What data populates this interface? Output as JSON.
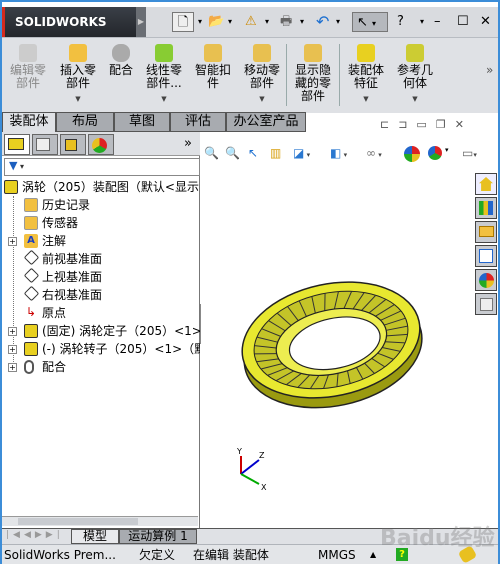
{
  "app": {
    "logo": "SOLIDWORKS"
  },
  "ribbon": {
    "buttons": [
      {
        "label": "编辑零\n部件",
        "disabled": true
      },
      {
        "label": "插入零\n部件"
      },
      {
        "label": "配合"
      },
      {
        "label": "线性零\n部件..."
      },
      {
        "label": "智能扣\n件"
      },
      {
        "label": "移动零\n部件"
      },
      {
        "label": "显示隐\n藏的零\n部件"
      },
      {
        "label": "装配体\n特征"
      },
      {
        "label": "参考几\n何体"
      }
    ],
    "more": "»"
  },
  "tabs": [
    "装配体",
    "布局",
    "草图",
    "评估",
    "办公室产品"
  ],
  "feature_tree": {
    "root": "涡轮（205）装配图（默认<显示",
    "items": [
      "历史记录",
      "传感器",
      "注解",
      "前视基准面",
      "上视基准面",
      "右视基准面",
      "原点",
      "(固定) 涡轮定子（205）<1>",
      "(-) 涡轮转子（205）<1>（默",
      "配合"
    ],
    "more": "»"
  },
  "bottom_tabs": [
    "模型",
    "运动算例 1"
  ],
  "status": {
    "product": "SolidWorks Prem...",
    "state": "欠定义",
    "mode": "在编辑 装配体",
    "units": "MMGS"
  },
  "watermark": "Baidu经验",
  "colors": {
    "part": "#e8e830",
    "accent": "#3c8dd8"
  }
}
